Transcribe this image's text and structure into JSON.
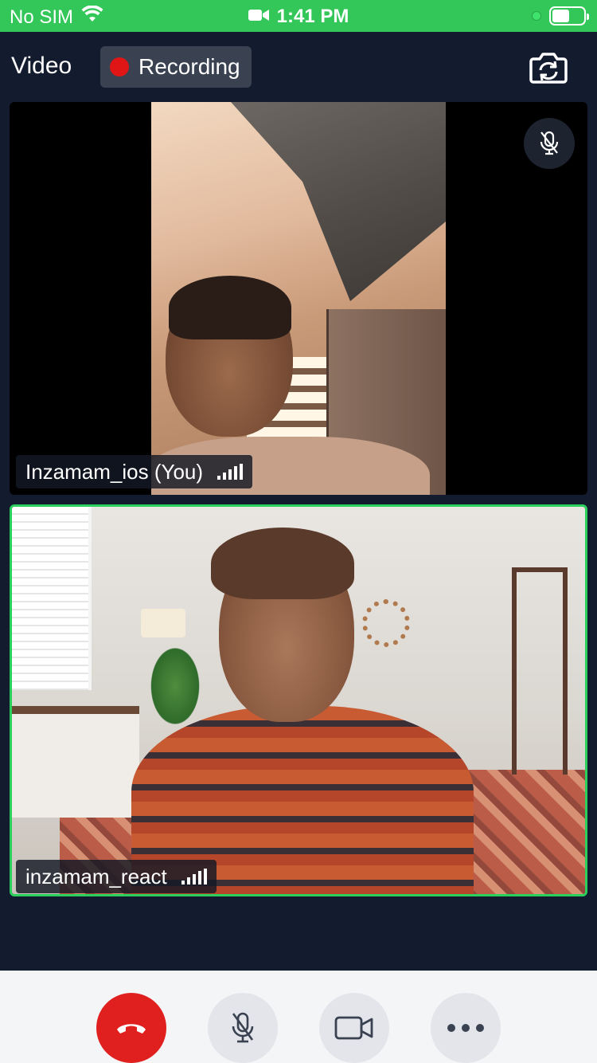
{
  "status_bar": {
    "carrier": "No SIM",
    "time": "1:41 PM",
    "battery_level": 0.55
  },
  "header": {
    "title": "Video",
    "recording_label": "Recording"
  },
  "participants": [
    {
      "name": "Inzamam_ios (You)",
      "signal_bars": 4,
      "muted": true,
      "active_speaker": false
    },
    {
      "name": "inzamam_react",
      "signal_bars": 4,
      "muted": false,
      "active_speaker": true
    }
  ],
  "colors": {
    "status_bar": "#33c659",
    "background": "#131b2e",
    "recording_dot": "#e01616",
    "active_speaker_border": "#2bd05c",
    "end_call": "#e0201f",
    "control_bar": "#f4f5f7"
  },
  "controls": {
    "end_call_icon": "phone-hangup-icon",
    "mic_icon": "mic-off-icon",
    "camera_icon": "video-camera-icon",
    "more_icon": "more-horizontal-icon"
  }
}
